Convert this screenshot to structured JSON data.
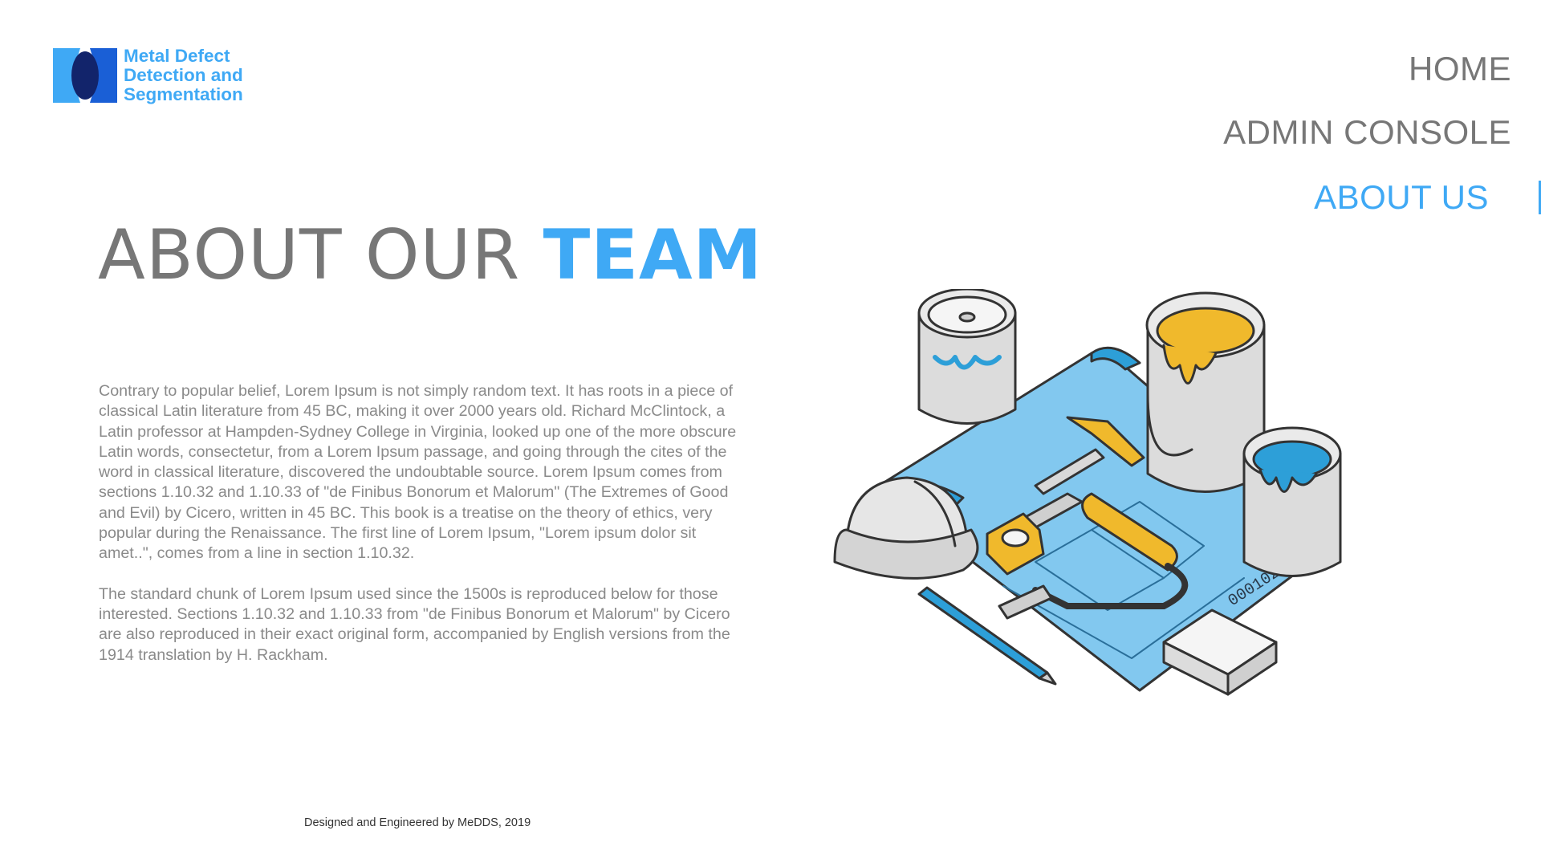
{
  "logo": {
    "lines": [
      "Metal Defect",
      "Detection and",
      "Segmentation"
    ],
    "icon": "logo-mark-icon"
  },
  "nav": {
    "items": [
      {
        "label": "HOME",
        "active": false
      },
      {
        "label": "ADMIN CONSOLE",
        "active": false
      },
      {
        "label": "ABOUT US",
        "active": true
      }
    ]
  },
  "page": {
    "title_prefix": "ABOUT OUR ",
    "title_accent": "TEAM",
    "paragraphs": [
      "Contrary to popular belief, Lorem Ipsum is not simply random text. It has roots in a piece of classical Latin literature from 45 BC, making it over 2000 years old. Richard McClintock, a Latin professor at Hampden-Sydney College in Virginia, looked up one of the more obscure Latin words, consectetur, from a Lorem Ipsum passage, and going through the cites of the word in classical literature, discovered the undoubtable source. Lorem Ipsum comes from sections 1.10.32 and 1.10.33 of \"de Finibus Bonorum et Malorum\" (The Extremes of Good and Evil) by Cicero, written in 45 BC. This book is a treatise on the theory of ethics, very popular during the Renaissance. The first line of Lorem Ipsum, \"Lorem ipsum dolor sit amet..\", comes from a line in section 1.10.32.",
      "The standard chunk of Lorem Ipsum used since the 1500s is reproduced below for those interested. Sections 1.10.32 and 1.10.33 from \"de Finibus Bonorum et Malorum\" by Cicero are also reproduced in their exact original form, accompanied by English versions from the 1914 translation by H. Rackham."
    ]
  },
  "illustration": {
    "icon": "construction-tools-illustration",
    "label": "0001020"
  },
  "footer": {
    "text": "Designed and Engineered by MeDDS, 2019"
  },
  "colors": {
    "accent": "#3fa9f5",
    "muted": "#777777",
    "paint_yellow": "#f0b92c",
    "paint_blue": "#2d9fd8"
  }
}
